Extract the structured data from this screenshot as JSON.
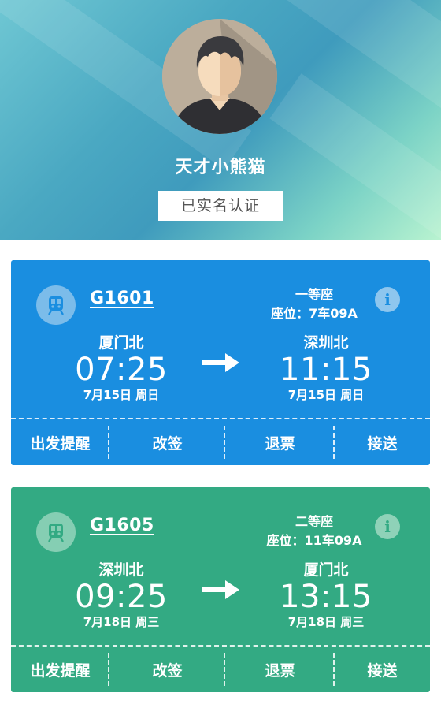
{
  "profile": {
    "username": "天才小熊猫",
    "verify_badge": "已实名认证",
    "avatar_icon": "user-avatar-icon"
  },
  "tickets": [
    {
      "theme": "blue",
      "color": "#1a8ee0",
      "train_no": "G1601",
      "seat_class": "一等座",
      "seat_no": "座位：7车09A",
      "from_station": "厦门北",
      "depart_time": "07:25",
      "depart_date": "7月15日 周日",
      "to_station": "深圳北",
      "arrive_time": "11:15",
      "arrive_date": "7月15日 周日",
      "actions": [
        "出发提醒",
        "改签",
        "退票",
        "接送"
      ]
    },
    {
      "theme": "green",
      "color": "#33aa83",
      "train_no": "G1605",
      "seat_class": "二等座",
      "seat_no": "座位：11车09A",
      "from_station": "深圳北",
      "depart_time": "09:25",
      "depart_date": "7月18日 周三",
      "to_station": "厦门北",
      "arrive_time": "13:15",
      "arrive_date": "7月18日 周三",
      "actions": [
        "出发提醒",
        "改签",
        "退票",
        "接送"
      ]
    }
  ],
  "icons": {
    "train": "train-icon",
    "info": "info-icon",
    "arrow": "arrow-right-icon"
  }
}
